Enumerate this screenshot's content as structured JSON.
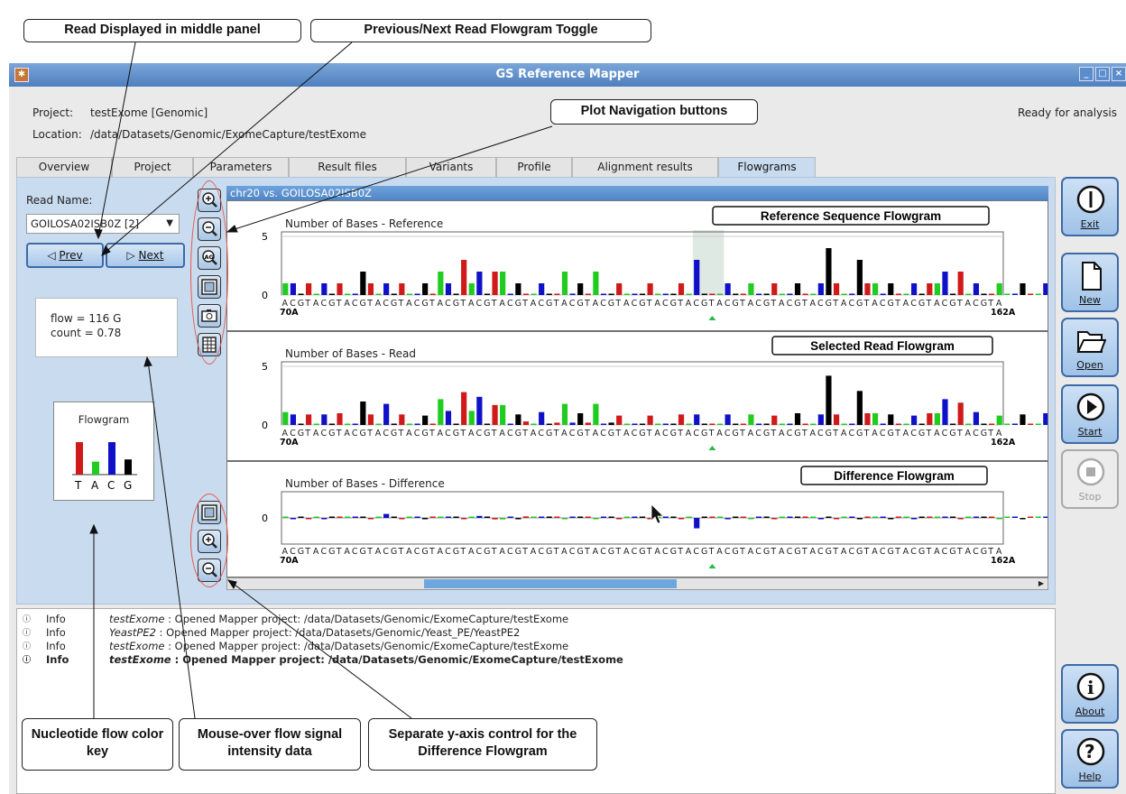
{
  "window": {
    "title": "GS Reference Mapper",
    "status": "Ready for analysis",
    "project_label": "Project:",
    "project_value": "testExome  [Genomic]",
    "location_label": "Location:",
    "location_value": "/data/Datasets/Genomic/ExomeCapture/testExome"
  },
  "tabs": [
    {
      "label": "Overview"
    },
    {
      "label": "Project"
    },
    {
      "label": "Parameters"
    },
    {
      "label": "Result files"
    },
    {
      "label": "Variants"
    },
    {
      "label": "Profile"
    },
    {
      "label": "Alignment results"
    },
    {
      "label": "Flowgrams",
      "active": true
    }
  ],
  "left_panel": {
    "read_name_label": "Read Name:",
    "read_name_value": "GOILOSA02ISB0Z [2]",
    "prev_label": "Prev",
    "next_label": "Next",
    "flow_text": "flow =  116 G",
    "count_text": "count =  0.78",
    "key_title": "Flowgram",
    "key_letters": [
      "T",
      "A",
      "C",
      "G"
    ],
    "key_values": [
      3,
      1.2,
      3,
      1.4
    ]
  },
  "plot": {
    "header": "chr20 vs. GOILOSA02ISB0Z",
    "sequence": "ACGTACGTACGTACGTACGTACGTACGTACGTACGTACGTACGTACGTACGTACGTACGTACGTACGTACGTACGTACGTACGTACGTACGTA",
    "range_start": "70A",
    "range_end": "162A",
    "colors": {
      "A": "#20cc20",
      "C": "#1010c8",
      "G": "#000000",
      "T": "#d01a1a"
    }
  },
  "chart_data": [
    {
      "type": "bar",
      "title": "Number of Bases - Reference",
      "ylim": [
        0,
        5
      ],
      "yticks": [
        "5",
        "0"
      ],
      "values": [
        1,
        1,
        0,
        1,
        0,
        1,
        0,
        1,
        0,
        0,
        2,
        1,
        0,
        1,
        0,
        1,
        0,
        0,
        1,
        0,
        2,
        1,
        0,
        3,
        1,
        2,
        0,
        2,
        2,
        0,
        1,
        0,
        0,
        1,
        0,
        0,
        2,
        0,
        1,
        0,
        2,
        0,
        0,
        1,
        0,
        0,
        0,
        1,
        0,
        0,
        0,
        1,
        0,
        3,
        0,
        0,
        0,
        1,
        0,
        0,
        1,
        0,
        0,
        1,
        0,
        0,
        1,
        0,
        0,
        1,
        4,
        1,
        0,
        0,
        3,
        1,
        1,
        0,
        1,
        0,
        0,
        1,
        0,
        1,
        1,
        2,
        0,
        2,
        0,
        1,
        0,
        0,
        1,
        0,
        0,
        1,
        0,
        0,
        1,
        1
      ]
    },
    {
      "type": "bar",
      "title": "Number of Bases - Read",
      "ylim": [
        0,
        5
      ],
      "yticks": [
        "5",
        "0"
      ],
      "values": [
        1.1,
        0.9,
        0.1,
        0.9,
        0.1,
        0.9,
        0.1,
        1,
        0.1,
        0.1,
        2,
        0.9,
        0.1,
        1.8,
        0.1,
        0.9,
        0.1,
        0.1,
        0.8,
        0.1,
        2.2,
        1.2,
        0.1,
        2.8,
        1.2,
        2.4,
        0.1,
        1.7,
        1.7,
        0.1,
        0.9,
        0.3,
        0.1,
        1.1,
        0.1,
        0.2,
        1.8,
        0.2,
        1,
        0.2,
        1.8,
        0.1,
        0.2,
        0.8,
        0.1,
        0.1,
        0.1,
        0.8,
        0.1,
        0.1,
        0.1,
        0.9,
        0.1,
        0.9,
        0.1,
        0.1,
        0.1,
        0.9,
        0.1,
        0.1,
        0.9,
        0.1,
        0.1,
        0.8,
        0.1,
        0.1,
        1,
        0.1,
        0.1,
        0.9,
        4.2,
        0.9,
        0.1,
        0.1,
        2.9,
        1,
        1,
        0.1,
        0.9,
        0.1,
        0.1,
        0.8,
        0.1,
        1,
        1,
        2.2,
        0.1,
        1.9,
        0.1,
        1.1,
        0.1,
        0.1,
        0.8,
        0.1,
        0.1,
        0.9,
        0.1,
        0.1,
        1,
        1
      ]
    },
    {
      "type": "bar",
      "title": "Number of Bases - Difference",
      "ylim": [
        -2,
        2
      ],
      "yticks": [
        "0"
      ],
      "values": [
        0.1,
        -0.1,
        0.1,
        -0.1,
        0.1,
        -0.1,
        0.1,
        0.1,
        0.1,
        0.1,
        0,
        -0.1,
        0.1,
        0.8,
        0.1,
        -0.1,
        0.1,
        0.1,
        -0.2,
        0.1,
        0.2,
        0.2,
        0.1,
        -0.2,
        0.2,
        0.4,
        0.1,
        -0.3,
        -0.3,
        0.1,
        -0.1,
        0.3,
        0.1,
        0.1,
        0.1,
        0.2,
        -0.2,
        0.2,
        0,
        0.2,
        -0.2,
        0.1,
        0.2,
        -0.2,
        0.1,
        0.1,
        0.1,
        -0.2,
        0.1,
        0.1,
        0.1,
        -0.1,
        0.1,
        -2.1,
        0.1,
        0.1,
        0.1,
        -0.1,
        0.1,
        0.1,
        -0.1,
        0.1,
        0.1,
        -0.2,
        0.1,
        0.1,
        0,
        0.1,
        0.1,
        -0.1,
        0.2,
        -0.1,
        0.1,
        0.1,
        -0.1,
        0,
        0,
        0.1,
        -0.1,
        0.1,
        0.1,
        -0.2,
        0.1,
        0,
        0,
        0.2,
        0.1,
        -0.1,
        0.1,
        0.1,
        0.1,
        0.1,
        -0.2,
        0.1,
        0.1,
        -0.1,
        0.1,
        0.1,
        0,
        0
      ]
    }
  ],
  "panel_titles": [
    "Reference Sequence Flowgram",
    "Selected Read Flowgram",
    "Difference Flowgram"
  ],
  "sidebar": {
    "exit": "Exit",
    "new": "New",
    "open": "Open",
    "start": "Start",
    "stop": "Stop",
    "about": "About",
    "help": "Help"
  },
  "log": [
    {
      "level": "Info",
      "project": "testExome",
      "message": " : Opened Mapper project:  /data/Datasets/Genomic/ExomeCapture/testExome",
      "bold": false
    },
    {
      "level": "Info",
      "project": "YeastPE2",
      "message": " : Opened Mapper project:  /data/Datasets/Genomic/Yeast_PE/YeastPE2",
      "bold": false
    },
    {
      "level": "Info",
      "project": "testExome",
      "message": " : Opened Mapper project:  /data/Datasets/Genomic/ExomeCapture/testExome",
      "bold": false
    },
    {
      "level": "Info",
      "project": "testExome",
      "message": " : Opened Mapper project:  /data/Datasets/Genomic/ExomeCapture/testExome",
      "bold": true
    }
  ],
  "callouts": {
    "read_displayed": "Read Displayed in middle panel",
    "toggle": "Previous/Next Read Flowgram Toggle",
    "plot_nav": "Plot Navigation buttons",
    "color_key": "Nucleotide flow color key",
    "mouse_over": "Mouse-over flow signal intensity data",
    "yaxis": "Separate y-axis control for the Difference Flowgram"
  }
}
